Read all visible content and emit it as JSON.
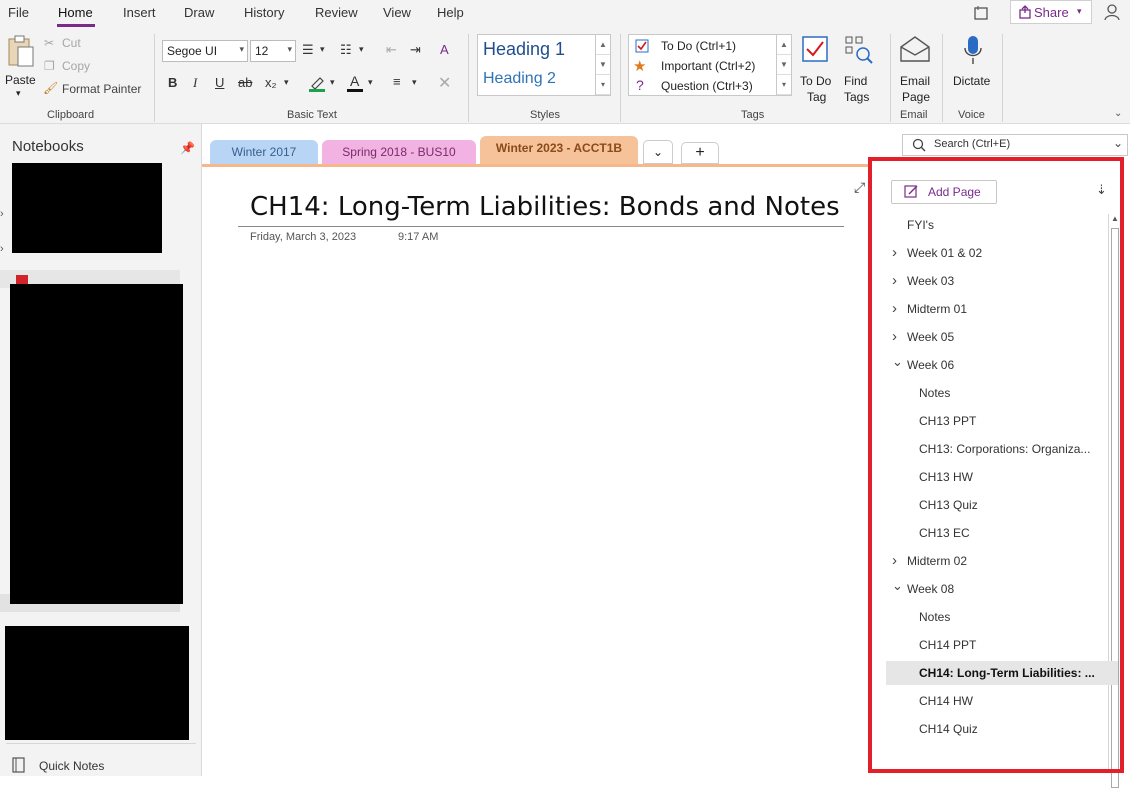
{
  "menu": {
    "items": [
      "File",
      "Home",
      "Insert",
      "Draw",
      "History",
      "Review",
      "View",
      "Help"
    ],
    "share_label": "Share"
  },
  "ribbon": {
    "clipboard": {
      "paste": "Paste",
      "cut": "Cut",
      "copy": "Copy",
      "format_painter": "Format Painter",
      "label": "Clipboard"
    },
    "basic_text": {
      "font": "Segoe UI",
      "size": "12",
      "label": "Basic Text"
    },
    "styles": {
      "heading1": "Heading 1",
      "heading2": "Heading 2",
      "label": "Styles"
    },
    "tags": {
      "todo": "To Do (Ctrl+1)",
      "important": "Important (Ctrl+2)",
      "question": "Question (Ctrl+3)",
      "label": "Tags"
    },
    "todo_tag": {
      "line1": "To Do",
      "line2": "Tag"
    },
    "find_tags": {
      "line1": "Find",
      "line2": "Tags"
    },
    "email": {
      "line1": "Email",
      "line2": "Page",
      "label": "Email"
    },
    "voice": {
      "dictate": "Dictate",
      "label": "Voice"
    }
  },
  "notebooks": {
    "header": "Notebooks",
    "quick_notes": "Quick Notes"
  },
  "search": {
    "placeholder": "Search (Ctrl+E)"
  },
  "section_tabs": [
    {
      "label": "Winter 2017",
      "color": "#b8d5f5"
    },
    {
      "label": "Spring 2018 - BUS10",
      "color": "#f2b3e2"
    },
    {
      "label": "Winter 2023 - ACCT1B",
      "color": "#f6c29a"
    }
  ],
  "page": {
    "title": "CH14: Long-Term Liabilities: Bonds and Notes",
    "date": "Friday, March 3, 2023",
    "time": "9:17 AM"
  },
  "pages_panel": {
    "add_page": "Add Page",
    "pages": [
      {
        "label": "FYI's",
        "level": 0,
        "chevron": ""
      },
      {
        "label": "Week 01 & 02",
        "level": 0,
        "chevron": "right"
      },
      {
        "label": "Week 03",
        "level": 0,
        "chevron": "right"
      },
      {
        "label": "Midterm 01",
        "level": 0,
        "chevron": "right"
      },
      {
        "label": "Week 05",
        "level": 0,
        "chevron": "right"
      },
      {
        "label": "Week 06",
        "level": 0,
        "chevron": "down"
      },
      {
        "label": "Notes",
        "level": 1,
        "chevron": ""
      },
      {
        "label": "CH13 PPT",
        "level": 1,
        "chevron": ""
      },
      {
        "label": "CH13: Corporations: Organiza...",
        "level": 1,
        "chevron": ""
      },
      {
        "label": "CH13 HW",
        "level": 1,
        "chevron": ""
      },
      {
        "label": "CH13 Quiz",
        "level": 1,
        "chevron": ""
      },
      {
        "label": "CH13 EC",
        "level": 1,
        "chevron": ""
      },
      {
        "label": "Midterm 02",
        "level": 0,
        "chevron": "right"
      },
      {
        "label": "Week 08",
        "level": 0,
        "chevron": "down"
      },
      {
        "label": "Notes",
        "level": 1,
        "chevron": ""
      },
      {
        "label": "CH14 PPT",
        "level": 1,
        "chevron": ""
      },
      {
        "label": "CH14: Long-Term Liabilities: ...",
        "level": 1,
        "chevron": "",
        "selected": true
      },
      {
        "label": "CH14 HW",
        "level": 1,
        "chevron": ""
      },
      {
        "label": "CH14 Quiz",
        "level": 1,
        "chevron": ""
      }
    ]
  },
  "colors": {
    "accent": "#7a2b8a",
    "highlight": "#e3202a"
  }
}
